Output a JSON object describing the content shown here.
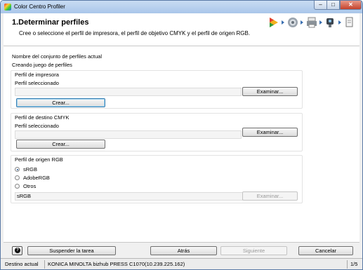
{
  "window": {
    "title": "Color Centro Profiler",
    "min_glyph": "–",
    "max_glyph": "□",
    "close_glyph": "✕"
  },
  "header": {
    "title": "1.Determinar perfiles",
    "description": "Cree o seleccione el perfil de impresora, el perfil de objetivo CMYK y el perfil de origen RGB.",
    "steps": [
      "step-determine-icon",
      "settings-gear-icon",
      "printer-icon",
      "measure-icon",
      "finish-icon"
    ]
  },
  "profile_set": {
    "label": "Nombre del conjunto de perfiles actual",
    "value": "Creando juego de perfiles"
  },
  "printer_profile": {
    "group_label": "Perfil de impresora",
    "selected_label": "Perfil seleccionado",
    "selected_value": "",
    "browse_label": "Examinar...",
    "create_label": "Crear..."
  },
  "cmyk_profile": {
    "group_label": "Perfil de destino CMYK",
    "selected_label": "Perfil seleccionado",
    "selected_value": "",
    "browse_label": "Examinar...",
    "create_label": "Crear..."
  },
  "rgb_profile": {
    "group_label": "Perfil de origen RGB",
    "options": [
      "sRGB",
      "AdobeRGB",
      "Otros"
    ],
    "selected_option": "sRGB",
    "selected_value": "sRGB",
    "browse_label": "Examinar..."
  },
  "footer": {
    "help_glyph": "?",
    "suspend_label": "Suspender la tarea",
    "back_label": "Atrás",
    "next_label": "Siguiente",
    "cancel_label": "Cancelar"
  },
  "status": {
    "label": "Destino actual",
    "device": "KONICA MINOLTA bizhub PRESS C1070(10.239.225.162)",
    "page": "1/5"
  },
  "colors": {
    "title_bar": "#b9d1ee",
    "close_button": "#c4422b",
    "accent": "#3a6fb0"
  }
}
